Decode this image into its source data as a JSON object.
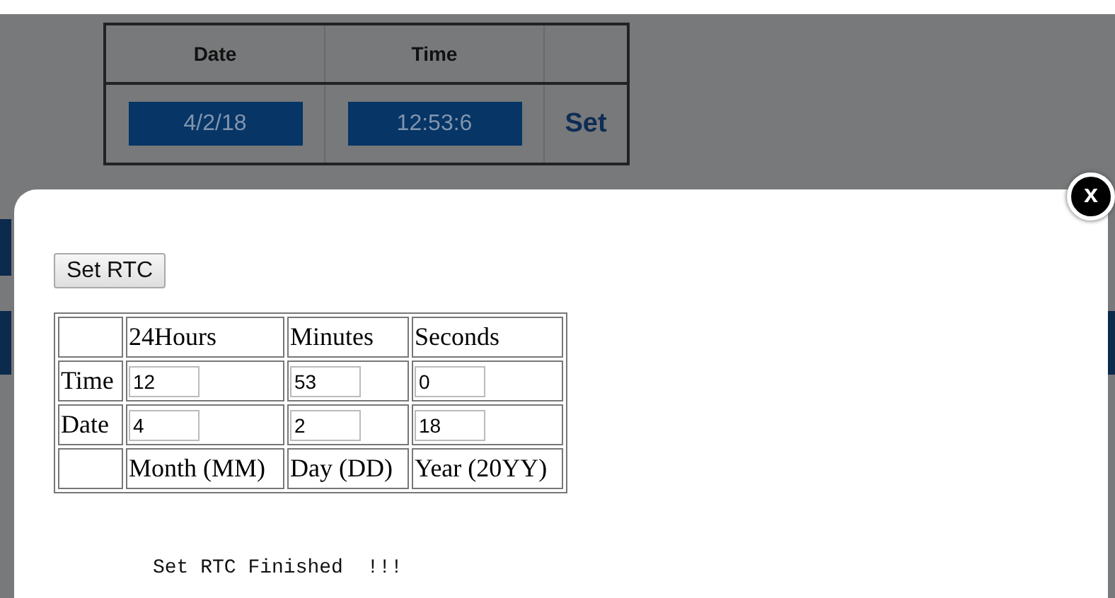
{
  "background": {
    "columns": [
      "Date",
      "Time"
    ],
    "date": "4/2/18",
    "time": "12:53:6",
    "set_label": "Set"
  },
  "modal": {
    "close_label": "x",
    "button": "Set RTC",
    "table": {
      "header": [
        "24Hours",
        "Minutes",
        "Seconds"
      ],
      "rows": [
        {
          "label": "Time",
          "values": [
            "12",
            "53",
            "0"
          ]
        },
        {
          "label": "Date",
          "values": [
            "4",
            "2",
            "18"
          ]
        }
      ],
      "footer": [
        "Month (MM)",
        "Day (DD)",
        "Year (20YY)"
      ]
    },
    "message": "Set RTC Finished  !!!"
  }
}
